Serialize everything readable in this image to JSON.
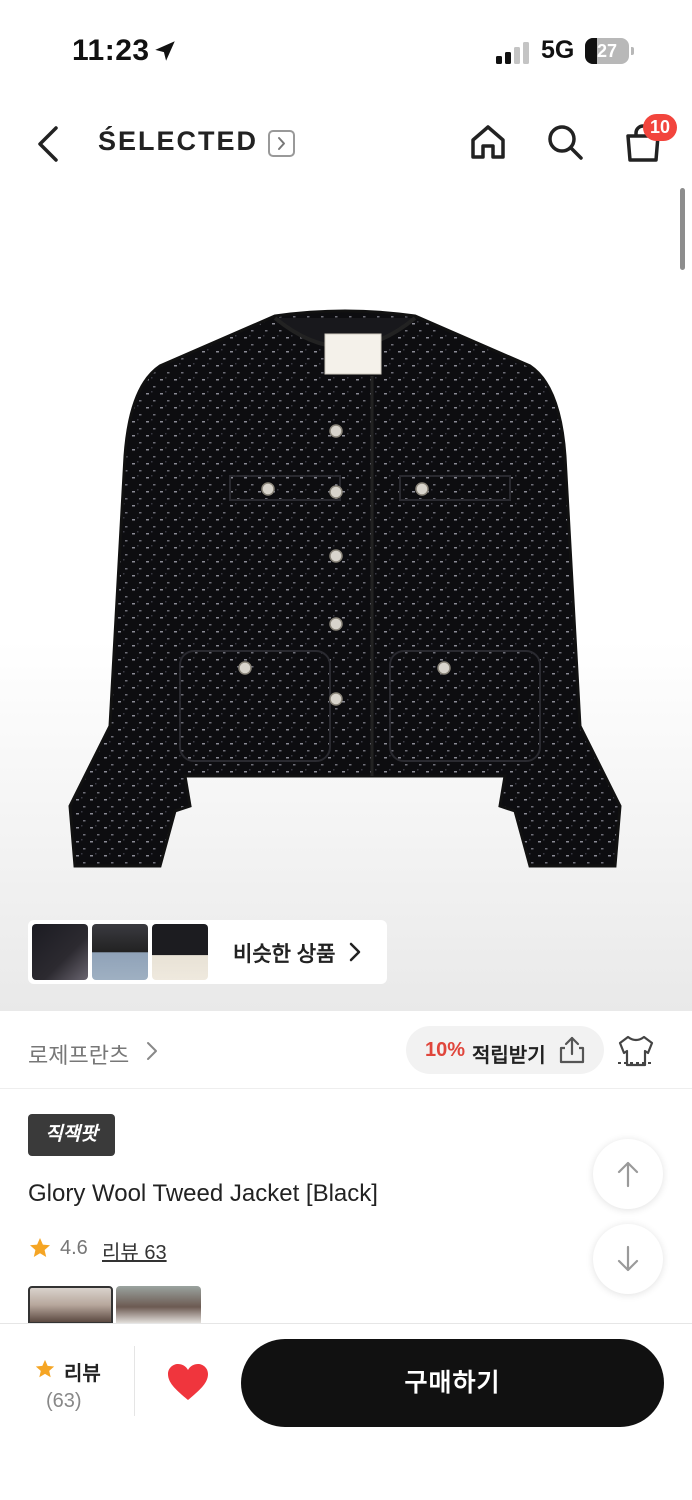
{
  "status_bar": {
    "time": "11:23",
    "network": "5G",
    "battery": "27",
    "battery_level": 0.27
  },
  "header": {
    "brand": "ŚELECTED",
    "cart_count": "10"
  },
  "hero": {
    "similar_label": "비슷한 상품"
  },
  "seller": {
    "name": "로제프란츠",
    "reward_percent": "10%",
    "reward_label": "적립받기"
  },
  "product": {
    "badge": "직잭팟",
    "name": "Glory Wool Tweed Jacket [Black]",
    "rating": "4.6",
    "review_link": "리뷰 63"
  },
  "bottom_bar": {
    "review_label": "리뷰",
    "review_count": "(63)",
    "buy_label": "구매하기"
  },
  "colors": {
    "badge_red": "#f2453d",
    "reward_red": "#e0463c",
    "star": "#f5a524",
    "heart": "#f0353d",
    "button": "#111111"
  }
}
